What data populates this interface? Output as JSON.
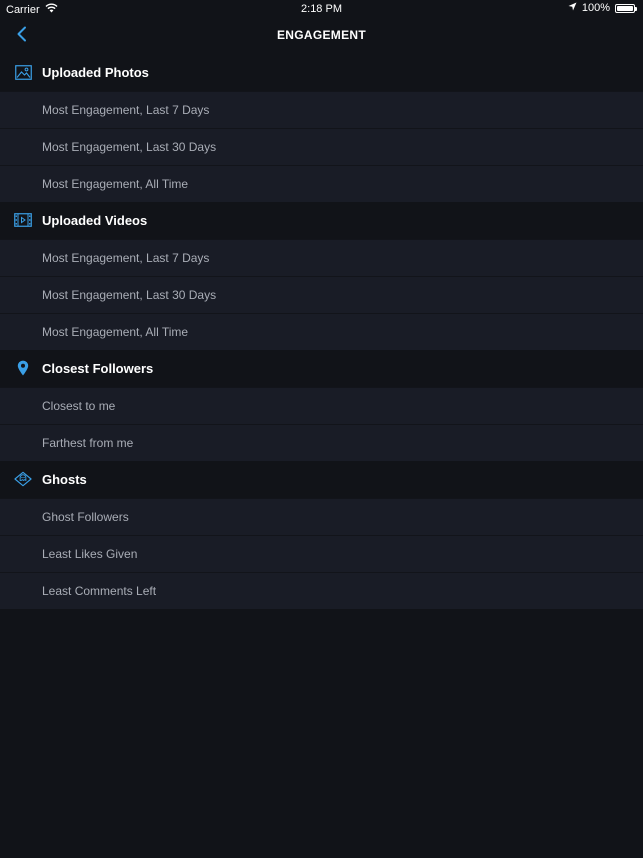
{
  "status_bar": {
    "carrier": "Carrier",
    "time": "2:18 PM",
    "battery": "100%",
    "battery_level": 1.0
  },
  "nav": {
    "title": "ENGAGEMENT",
    "back_icon": "chevron-left-icon"
  },
  "colors": {
    "accent": "#3a9fe6",
    "background": "#111318",
    "row_background": "#191c26",
    "row_text": "#a9adb6"
  },
  "sections": [
    {
      "title": "Uploaded Photos",
      "icon": "photo-icon",
      "items": [
        "Most Engagement, Last 7 Days",
        "Most Engagement, Last 30 Days",
        "Most Engagement, All Time"
      ]
    },
    {
      "title": "Uploaded Videos",
      "icon": "video-icon",
      "items": [
        "Most Engagement, Last 7 Days",
        "Most Engagement, Last 30 Days",
        "Most Engagement, All Time"
      ]
    },
    {
      "title": "Closest Followers",
      "icon": "location-pin-icon",
      "items": [
        "Closest to me",
        "Farthest from me"
      ]
    },
    {
      "title": "Ghosts",
      "icon": "ghost-icon",
      "items": [
        "Ghost Followers",
        "Least Likes Given",
        "Least Comments Left"
      ]
    }
  ]
}
